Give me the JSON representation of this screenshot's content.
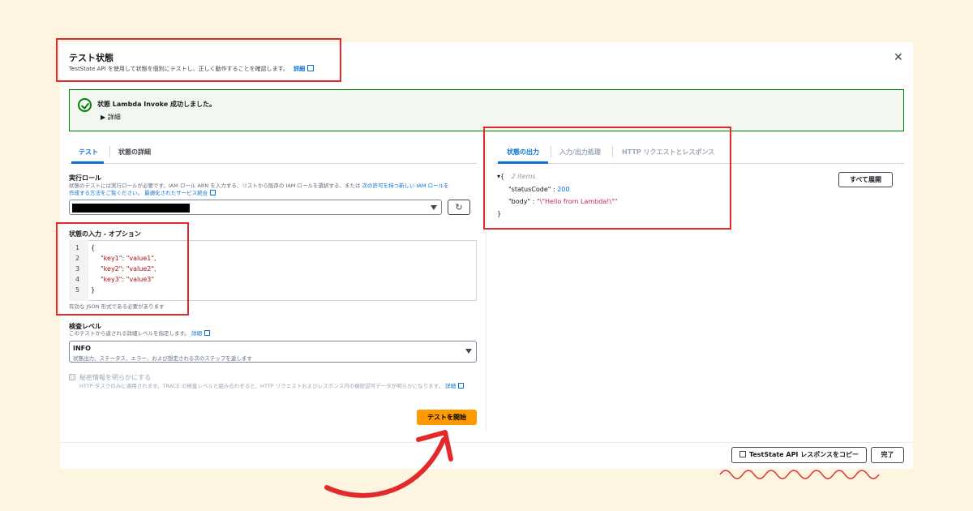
{
  "header": {
    "title": "テスト状態",
    "description": "TestState API を使用して状態を個別にテストし、正しく動作することを確認します。",
    "details_link": "詳細"
  },
  "alert": {
    "title": "状態 Lambda Invoke 成功しました。",
    "details_toggle": "▶ 詳細"
  },
  "left_tabs": [
    {
      "label": "テスト",
      "active": true
    },
    {
      "label": "状態の詳細",
      "active": false
    }
  ],
  "role": {
    "label": "実行ロール",
    "description_line1": "状態のテストには実行ロールが必要です。IAM ロール ARN を入力する、リストから既存の IAM ロールを選択する、または",
    "link1": "次の許可を持つ新しい IAM ロールを",
    "link1_cont": "作成する方法をご覧ください。",
    "link2": "最適化されたサービス統合"
  },
  "state_input": {
    "label": "状態の入力 - オプション",
    "lines": [
      {
        "n": "1",
        "text": "{"
      },
      {
        "n": "2",
        "key": "\"key1\"",
        "val": "\"value1\","
      },
      {
        "n": "3",
        "key": "\"key2\"",
        "val": "\"value2\","
      },
      {
        "n": "4",
        "key": "\"key3\"",
        "val": "\"value3\""
      },
      {
        "n": "5",
        "text": "}"
      }
    ],
    "hint": "有効な JSON 形式である必要があります"
  },
  "inspection": {
    "label": "検査レベル",
    "description": "このテストから返される詳細レベルを指定します。",
    "details_link": "詳細",
    "selected_value": "INFO",
    "selected_desc": "状態出力、ステータス、エラー、および想定される次のステップを返します"
  },
  "reveal_secrets": {
    "label": "秘密情報を明らかにする",
    "description": "HTTP タスクのみに適用されます。TRACE の検査レベルと組み合わせると、HTTP リクエストおよびレスポンス内の機密認可データが明らかになります。",
    "details_link": "詳細"
  },
  "start_button": "テストを開始",
  "right_tabs": [
    {
      "label": "状態の出力",
      "active": true
    },
    {
      "label": "入力/出力処理",
      "active": false
    },
    {
      "label": "HTTP リクエストとレスポンス",
      "active": false
    }
  ],
  "output": {
    "open_brace": "{",
    "items_count": "2 items",
    "status_key": "\"statusCode\"",
    "status_val": "200",
    "body_key": "\"body\"",
    "body_val": "\"\\\"Hello from Lambda!\\\"\"",
    "close_brace": "}",
    "expand_all": "すべて展開"
  },
  "footer": {
    "copy_button": "TestState API レスポンスをコピー",
    "done_button": "完了"
  },
  "colors": {
    "primary": "#ff9900",
    "link": "#0972d3",
    "success": "#037f0c",
    "highlight": "#e22a2a",
    "background": "#fdf4e1"
  }
}
